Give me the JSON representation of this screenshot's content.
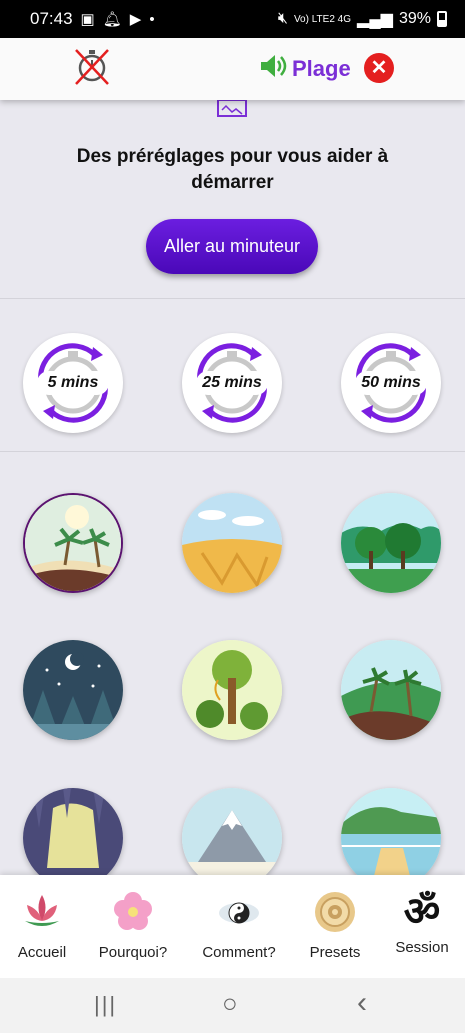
{
  "status_bar": {
    "time": "07:43",
    "network": "Vo) LTE2 4G",
    "battery": "39%"
  },
  "top_bar": {
    "sound_label": "Plage",
    "close_glyph": "✕",
    "timer_icon": "timer-off-icon",
    "sound_icon": "speaker-icon"
  },
  "main": {
    "heading": "Des préréglages pour vous aider à démarrer",
    "go_button": "Aller au minuteur",
    "presets": [
      {
        "label": "5 mins"
      },
      {
        "label": "25 mins"
      },
      {
        "label": "50 mins"
      }
    ],
    "scenes": [
      "beach",
      "desert",
      "forest",
      "night-forest",
      "jungle",
      "tropical",
      "cave",
      "mountain",
      "lake"
    ]
  },
  "bottom_nav": [
    {
      "label": "Accueil",
      "icon": "lotus-icon"
    },
    {
      "label": "Pourquoi?",
      "icon": "flower-icon"
    },
    {
      "label": "Comment?",
      "icon": "yin-yang-icon"
    },
    {
      "label": "Presets",
      "icon": "mandala-icon"
    },
    {
      "label": "Session",
      "icon": "om-icon"
    }
  ],
  "system_nav": {
    "recents": "|||",
    "home": "○",
    "back": "‹"
  },
  "colors": {
    "accent": "#7b2fd6",
    "button": "#5b14cc",
    "close": "#e41f1f",
    "background": "#e9e8ef"
  }
}
